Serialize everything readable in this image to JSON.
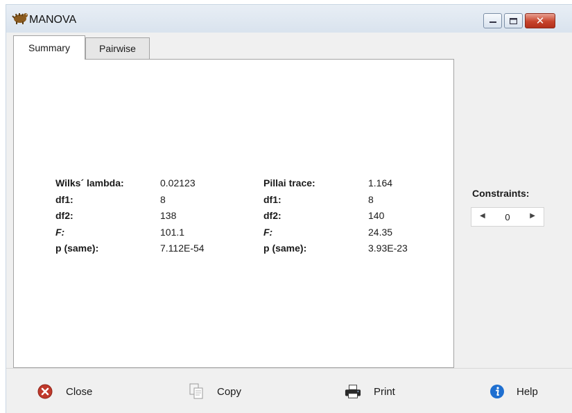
{
  "window": {
    "title": "MANOVA",
    "tabs": [
      "Summary",
      "Pairwise"
    ],
    "selected_tab": "Summary"
  },
  "wilks": {
    "rows": [
      {
        "label": "Wilks´  lambda:",
        "value": "0.02123"
      },
      {
        "label": "df1:",
        "value": "8"
      },
      {
        "label": "df2:",
        "value": "138"
      },
      {
        "label": "F:",
        "value": "101.1"
      },
      {
        "label": "p  (same):",
        "value": "7.112E-54"
      }
    ]
  },
  "pillai": {
    "rows": [
      {
        "label": "Pillai  trace:",
        "value": "1.164"
      },
      {
        "label": "df1:",
        "value": "8"
      },
      {
        "label": "df2:",
        "value": "140"
      },
      {
        "label": "F:",
        "value": "24.35"
      },
      {
        "label": "p  (same):",
        "value": "3.93E-23"
      }
    ]
  },
  "side": {
    "constraints_label": "Constraints:",
    "constraints_value": "0"
  },
  "buttons": {
    "close": "Close",
    "copy": "Copy",
    "print": "Print",
    "help": "Help"
  },
  "icons": {
    "app": "dinosaur-icon",
    "close": "close-circle-icon",
    "copy": "copy-icon",
    "print": "printer-icon",
    "help": "info-icon"
  },
  "colors": {
    "close_red": "#c0392b",
    "help_blue": "#1f6fd0"
  }
}
